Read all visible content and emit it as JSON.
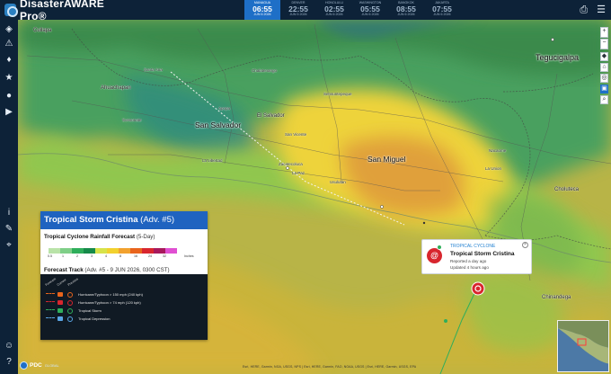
{
  "app": {
    "title": "DisasterAWARE Pro®"
  },
  "timeline": [
    {
      "label": "MANAGUA",
      "time": "06:55",
      "date": "JUN 6 2026",
      "active": true
    },
    {
      "label": "DENVER",
      "time": "22:55",
      "date": "JUN 5 2026",
      "active": false
    },
    {
      "label": "HONOLULU",
      "time": "02:55",
      "date": "JUN 6 2026",
      "active": false
    },
    {
      "label": "WASHINGTON",
      "time": "05:55",
      "date": "JUN 6 2026",
      "active": false
    },
    {
      "label": "BANGKOK",
      "time": "08:55",
      "date": "JUN 6 2026",
      "active": false
    },
    {
      "label": "JAKARTA",
      "time": "07:55",
      "date": "JUN 6 2026",
      "active": false
    }
  ],
  "top_icons": [
    {
      "name": "print-icon",
      "glyph": "⎙"
    },
    {
      "name": "menu-icon",
      "glyph": "☰"
    }
  ],
  "left_rail": [
    {
      "name": "layers-icon",
      "glyph": "◈"
    },
    {
      "name": "hazard-icon",
      "glyph": "⚠"
    },
    {
      "name": "alert-bell-icon",
      "glyph": "♦"
    },
    {
      "name": "favorites-icon",
      "glyph": "★"
    },
    {
      "name": "location-pin-icon",
      "glyph": "●"
    },
    {
      "name": "video-icon",
      "glyph": "▶"
    },
    {
      "name": "info-icon",
      "glyph": "i"
    },
    {
      "name": "measure-icon",
      "glyph": "✎"
    },
    {
      "name": "user-icon",
      "glyph": "☺"
    },
    {
      "name": "help-icon",
      "glyph": "?"
    }
  ],
  "map": {
    "cities": {
      "san_salvador": "San Salvador",
      "el_salvador": "El Salvador",
      "san_miguel": "San Miguel",
      "tegucigalpa": "Tegucigalpa",
      "cuilapa": "Cuilapa",
      "ahuachapan": "Ahuachapan",
      "la_libertad": "La Libertad",
      "choluteca": "Choluteca",
      "chinandega": "Chinandega",
      "apopa": "Apopa",
      "la_union": "La Union",
      "usulutan": "Usulután",
      "sensuntepeque": "Sensuntepeque",
      "chalatenango": "Chalatenango",
      "santa_ana": "Santa Ana",
      "sonsonate": "Sonsonate",
      "zacatecoluca": "Zacatecoluca",
      "la_paz": "La Paz",
      "nacaome": "Nacaome",
      "san_vicente": "San Vicente"
    }
  },
  "legend": {
    "title": "Tropical Storm Cristina",
    "advisory": "(Adv. #5)",
    "rainfall_title": "Tropical Cyclone Rainfall Forecast",
    "rainfall_sub": "(5-Day)",
    "scale_colors": [
      "#b9e3a8",
      "#7fcf88",
      "#2fae5b",
      "#168a4a",
      "#d7e34a",
      "#f2d12e",
      "#f2a12e",
      "#e8641c",
      "#d8262e",
      "#a8195c",
      "#e04fd2"
    ],
    "scale_labels": [
      "0.5",
      "1",
      "2",
      "3",
      "4",
      "8",
      "16",
      "24",
      "32",
      "Inches"
    ],
    "track_title": "Forecast Track",
    "track_sub": "(Adv. #5 - 9 JUN 2026, 0300 CST)",
    "col_headers": [
      "Forecast",
      "Current",
      "Previous"
    ],
    "track_items": [
      {
        "label": "Hurricane/Typhoon > 150 mph (240 kph)",
        "color": "#e8641c"
      },
      {
        "label": "Hurricane/Typhoon > 74 mph (120 kph)",
        "color": "#d8262e"
      },
      {
        "label": "Tropical Storm",
        "color": "#2fae5b"
      },
      {
        "label": "Tropical Depression",
        "color": "#5aa6e6"
      }
    ]
  },
  "popup": {
    "type": "TROPICAL CYCLONE",
    "name": "Tropical Storm Cristina",
    "reported": "Reported a day ago",
    "updated": "Updated 4 hours ago"
  },
  "footer": {
    "logo_text": "PDC",
    "logo_sub": "GLOBAL",
    "attribution": "Esri, HERE, Garmin, NGA, USGS, NPS | Esri, HERE, Garmin, FAO, NOAA, USGS | Esri, HERE, Garmin, USGS, EPA"
  }
}
